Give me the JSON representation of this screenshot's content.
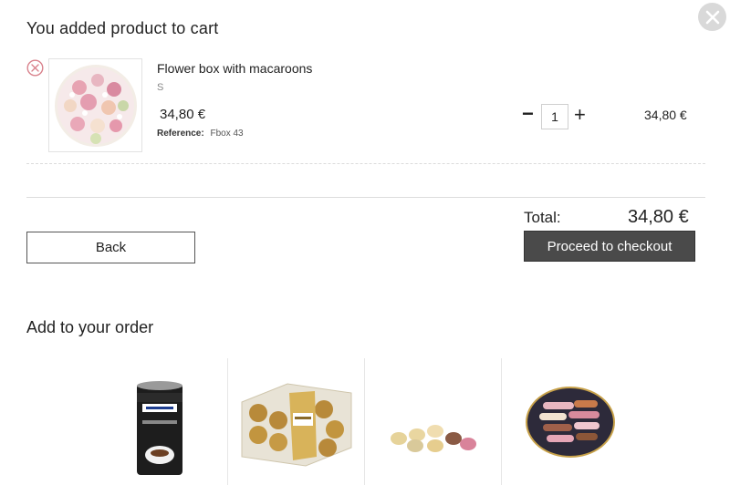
{
  "modal": {
    "title": "You added product to cart"
  },
  "cart_item": {
    "name": "Flower box with macaroons",
    "variant": "S",
    "price": "34,80 €",
    "reference_label": "Reference:",
    "reference_value": "Fbox 43",
    "quantity": "1",
    "qty_minus": "−",
    "qty_plus": "+",
    "line_total": "34,80 €"
  },
  "summary": {
    "total_label": "Total:",
    "total_value": "34,80 €",
    "back_label": "Back",
    "checkout_label": "Proceed to checkout"
  },
  "suggestions": {
    "title": "Add to your order",
    "items": [
      {
        "name": "lavazza-coffee-can"
      },
      {
        "name": "ferrero-rocher-box"
      },
      {
        "name": "macarons-plate"
      },
      {
        "name": "eclairs-tray"
      }
    ]
  },
  "colors": {
    "checkout_bg": "#4a4a4a",
    "close_bg": "#d9d9d9",
    "remove_icon": "#d9828c"
  },
  "icons": {
    "close": "close-icon",
    "remove": "remove-circle-icon"
  }
}
